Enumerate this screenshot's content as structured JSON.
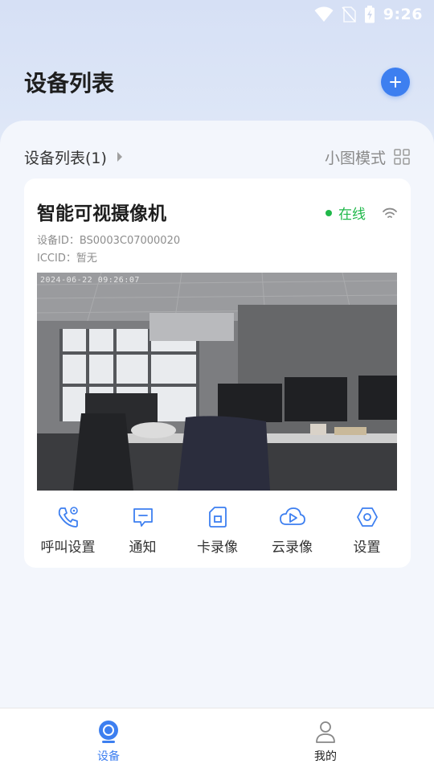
{
  "status_bar": {
    "time": "9:26"
  },
  "header": {
    "title": "设备列表"
  },
  "list": {
    "title": "设备列表(1)",
    "view_mode_label": "小图模式"
  },
  "device": {
    "name": "智能可视摄像机",
    "status": "在线",
    "status_color": "#20b84a",
    "device_id_line": "设备ID：BS0003C07000020",
    "iccid_line": "ICCID：暂无",
    "preview_timestamp": "2024-06-22 09:26:07"
  },
  "actions": [
    {
      "label": "呼叫设置",
      "icon": "phone-call-icon"
    },
    {
      "label": "通知",
      "icon": "message-icon"
    },
    {
      "label": "卡录像",
      "icon": "sd-card-icon"
    },
    {
      "label": "云录像",
      "icon": "cloud-play-icon"
    },
    {
      "label": "设置",
      "icon": "hexagon-settings-icon"
    }
  ],
  "tabbar": {
    "tabs": [
      {
        "label": "设备",
        "icon": "camera-device-icon",
        "active": true
      },
      {
        "label": "我的",
        "icon": "person-icon",
        "active": false
      }
    ]
  },
  "colors": {
    "accent": "#3d7ff0",
    "online": "#20b84a"
  }
}
